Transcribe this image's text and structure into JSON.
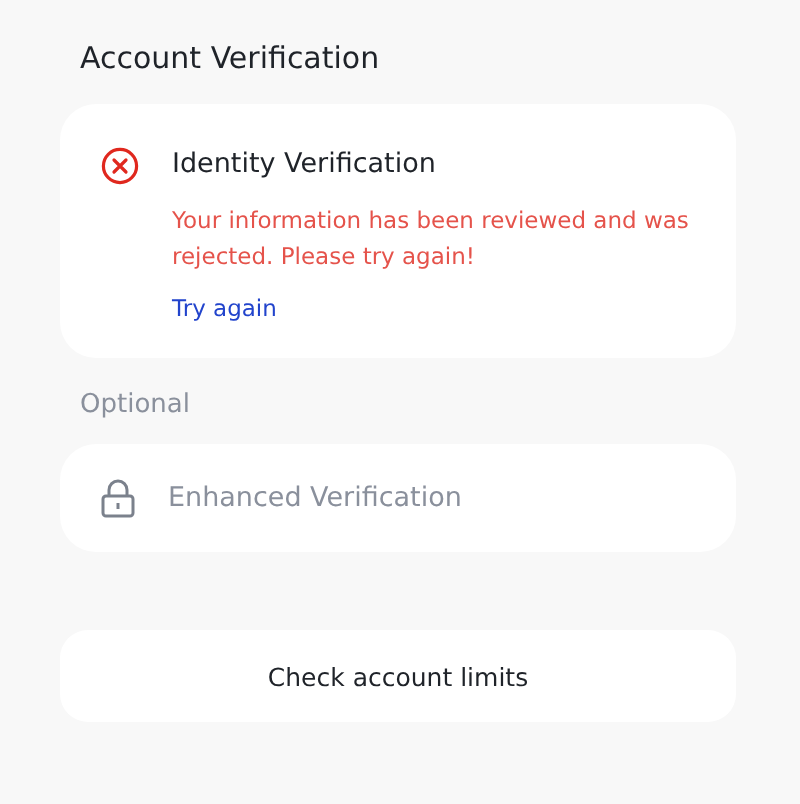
{
  "title": "Account Verification",
  "primary": {
    "kind": "rejected",
    "name": "Identity Verification",
    "message": "Your information has been reviewed and was rejected. Please try again!",
    "action": "Try again"
  },
  "optional_label": "Optional",
  "optional": {
    "kind": "locked",
    "name": "Enhanced Verification",
    "disabled": true
  },
  "limits_button": "Check account limits"
}
